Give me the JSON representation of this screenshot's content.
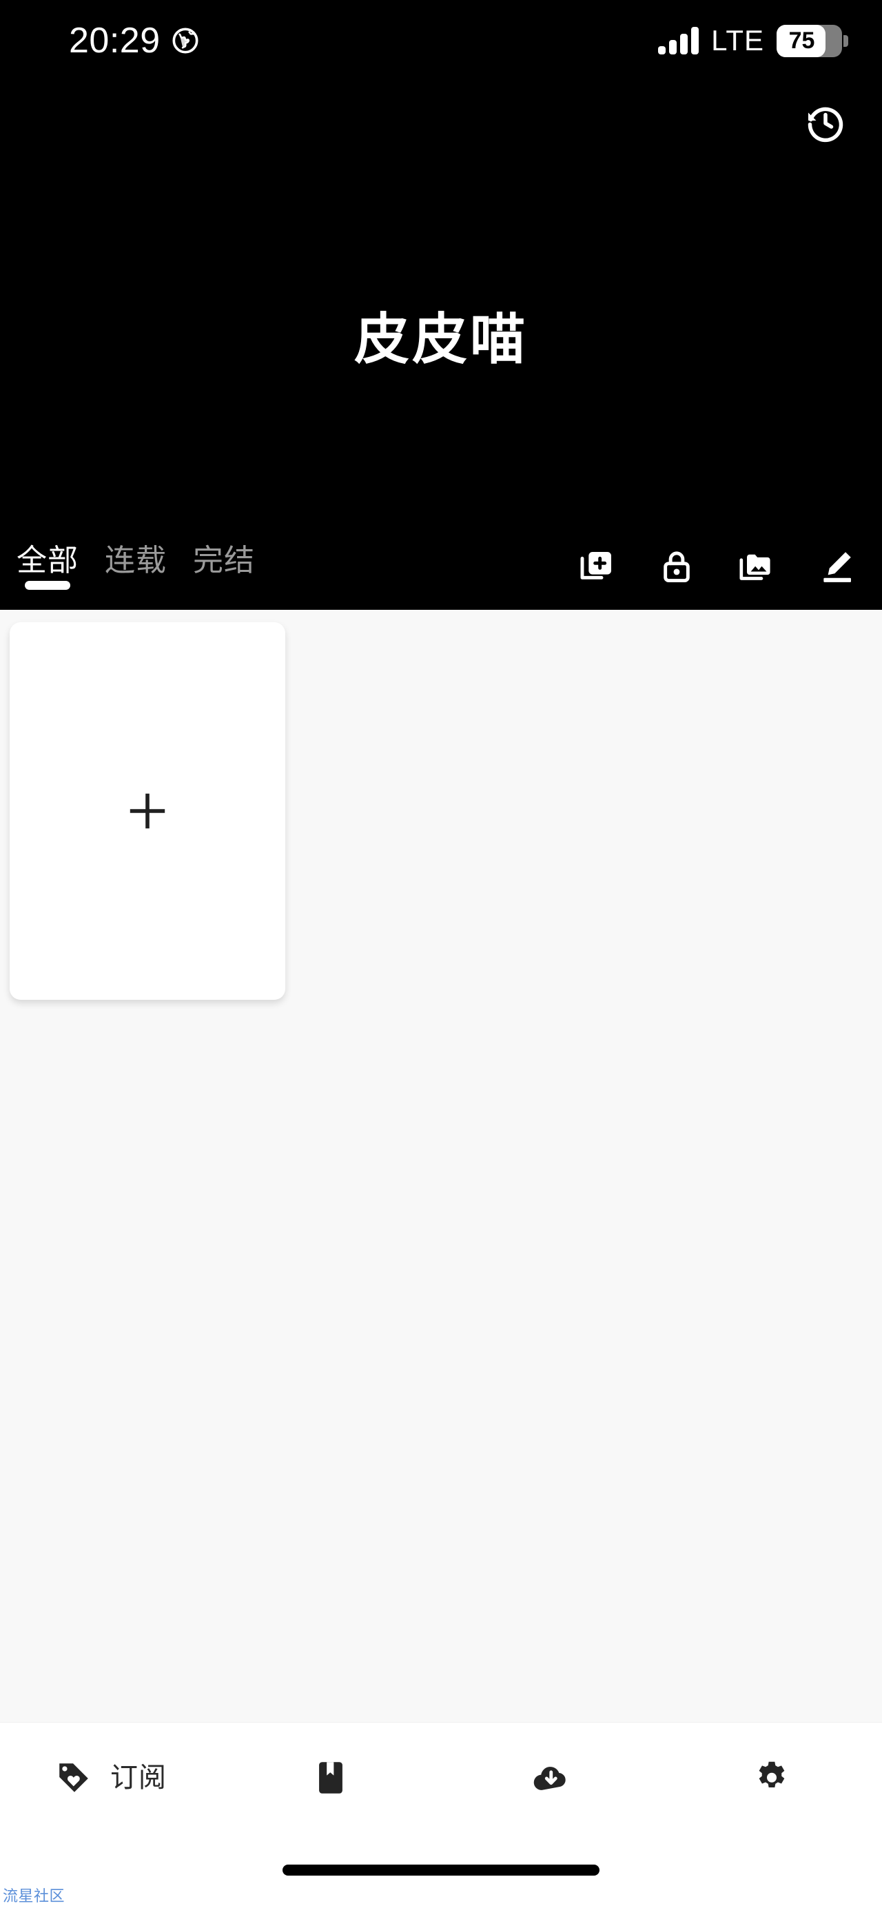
{
  "status_bar": {
    "time": "20:29",
    "globe_icon": "globe-icon",
    "network_type": "LTE",
    "battery_percent": "75",
    "signal_icon": "signal-bars-icon"
  },
  "header": {
    "app_title": "皮皮喵",
    "history_icon": "history-icon",
    "background_color": "#000000",
    "text_color": "#ffffff"
  },
  "tabs": [
    {
      "label": "全部",
      "active": true
    },
    {
      "label": "连载",
      "active": false
    },
    {
      "label": "完结",
      "active": false
    }
  ],
  "header_tools": [
    {
      "name": "add-library-icon",
      "label": "添加书库"
    },
    {
      "name": "lock-icon",
      "label": "隐私锁"
    },
    {
      "name": "photo-library-icon",
      "label": "本地漫画"
    },
    {
      "name": "edit-icon",
      "label": "编辑"
    }
  ],
  "content": {
    "background_color": "#f8f8f8",
    "cards": [
      {
        "type": "add-card",
        "icon": "plus-icon",
        "label": "+"
      }
    ]
  },
  "bottom_nav": [
    {
      "name": "subscribe",
      "icon": "tag-heart-icon",
      "label": "订阅"
    },
    {
      "name": "bookshelf",
      "icon": "bookmark-icon",
      "label": ""
    },
    {
      "name": "downloads",
      "icon": "cloud-download-icon",
      "label": ""
    },
    {
      "name": "settings",
      "icon": "gear-icon",
      "label": ""
    }
  ],
  "footer": {
    "watermark": "流星社区",
    "watermark_color": "#5b8fd9"
  }
}
